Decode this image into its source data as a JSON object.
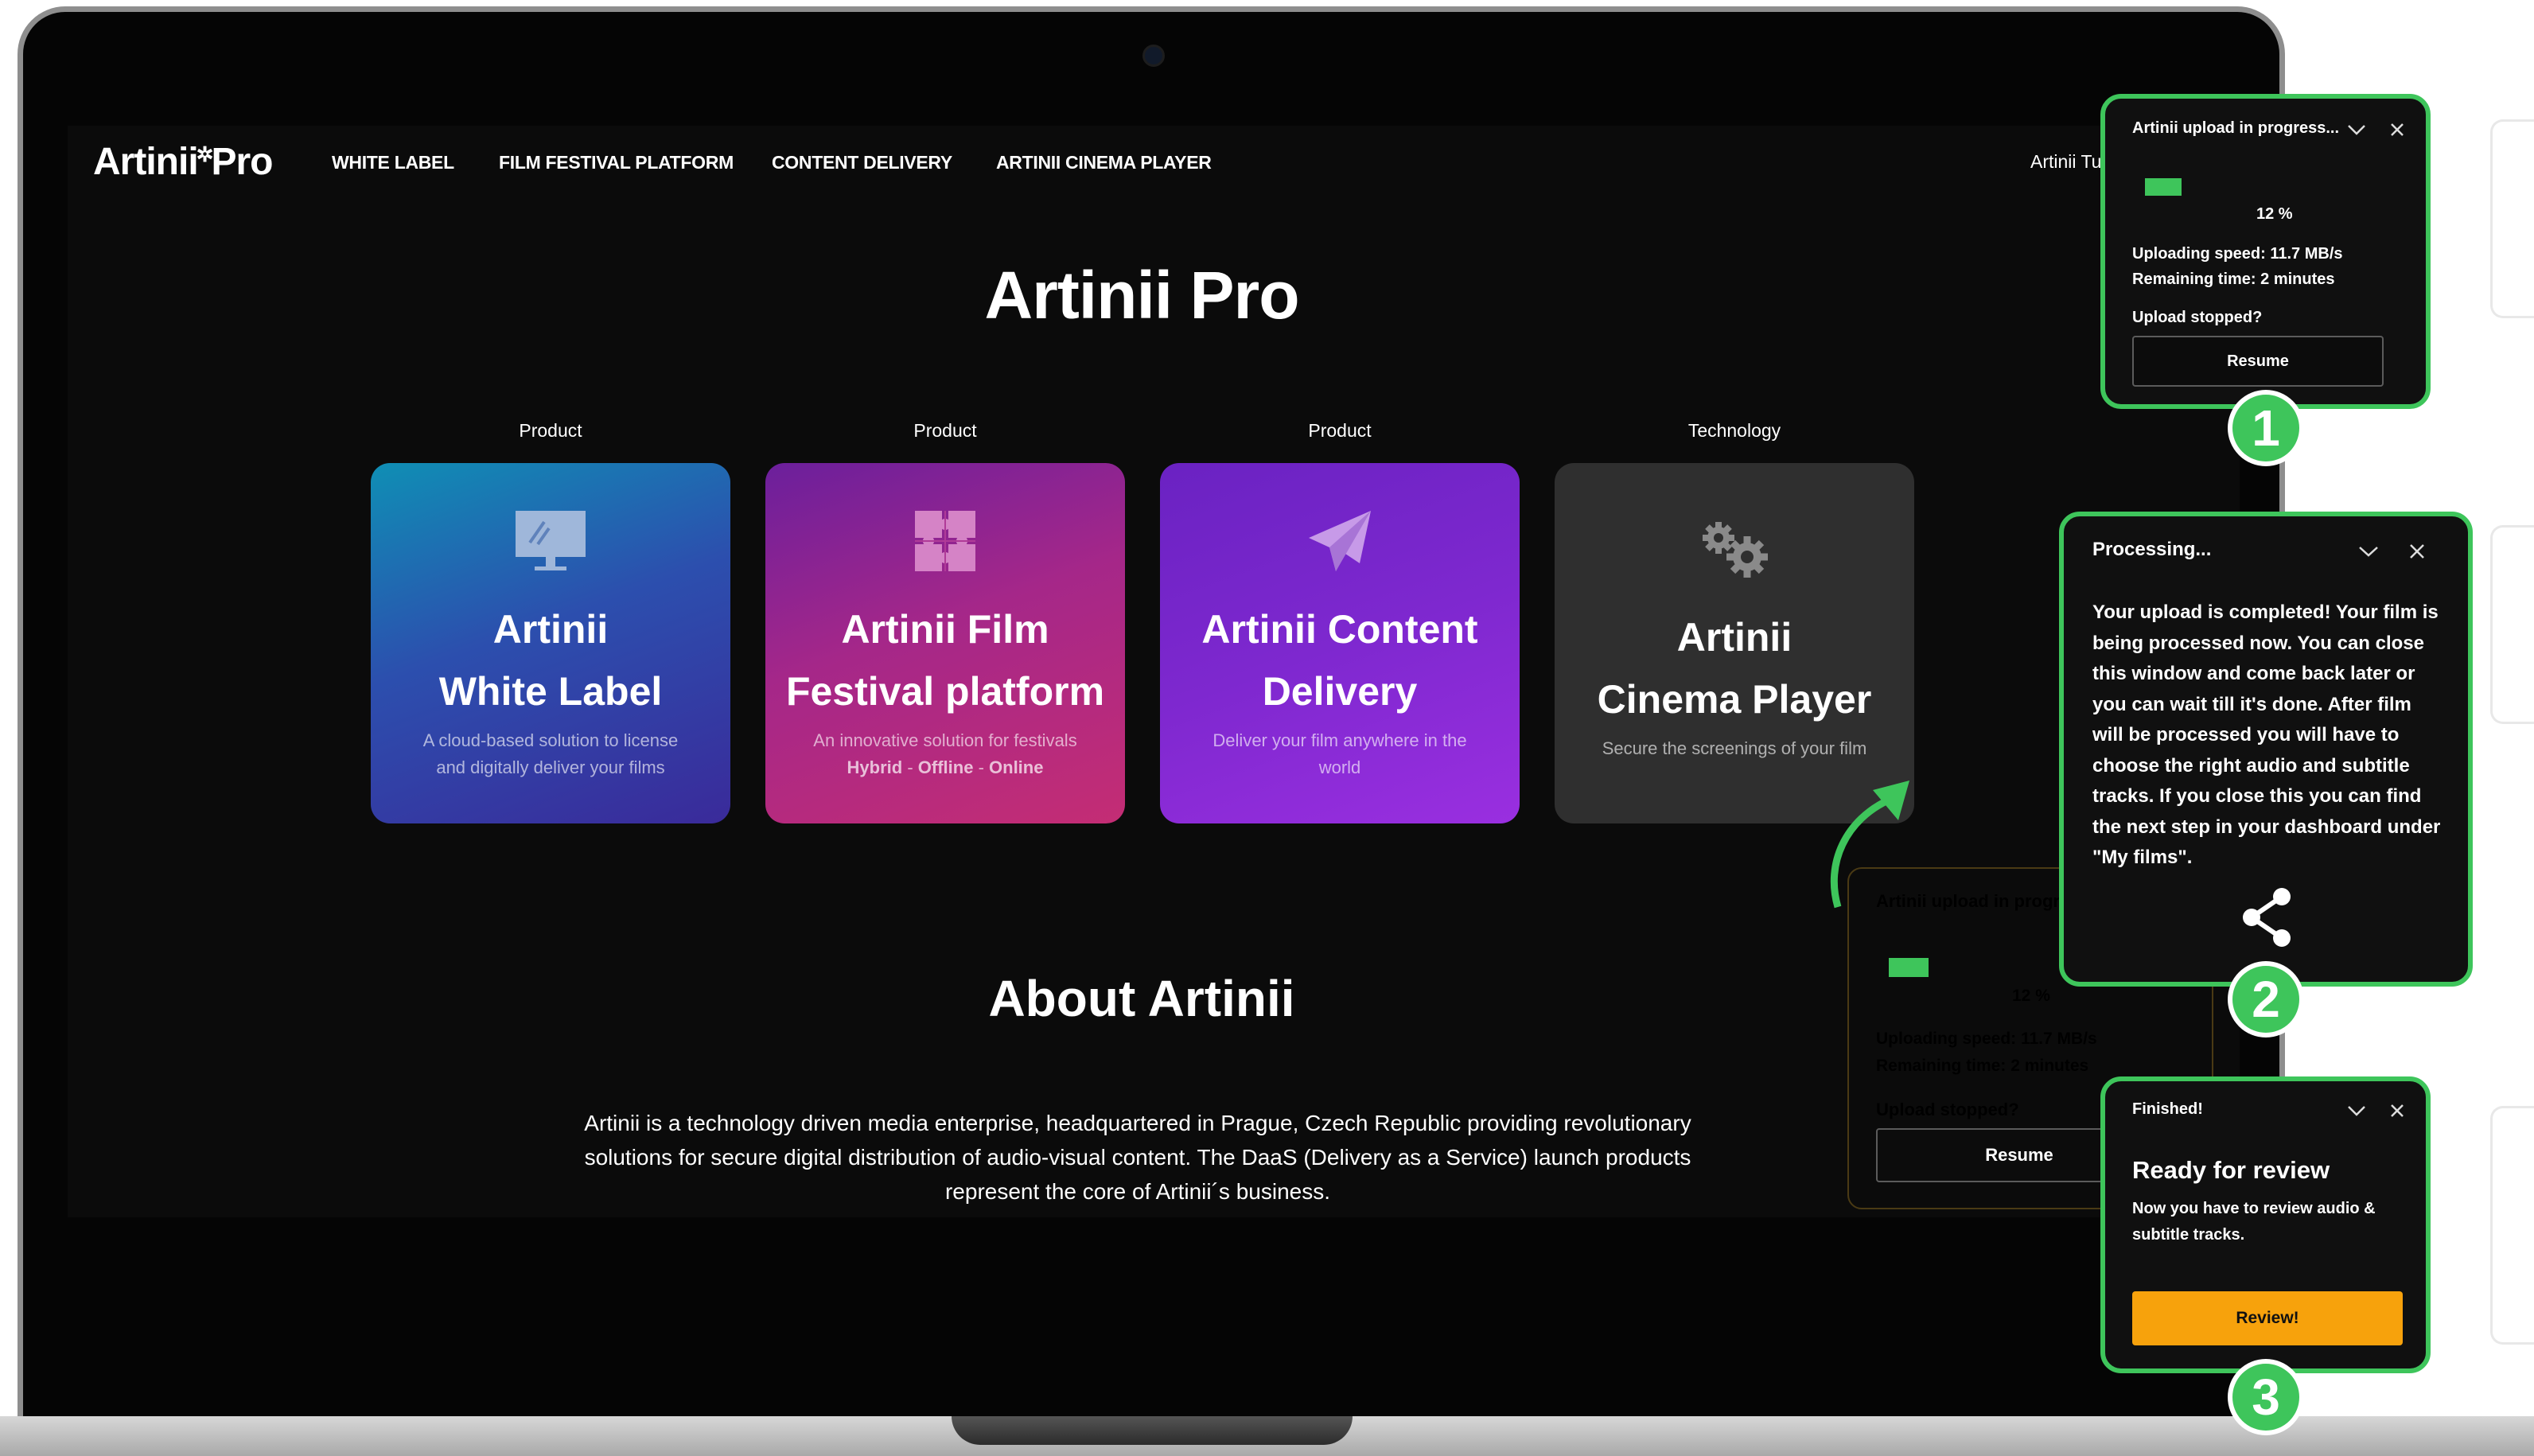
{
  "site": {
    "logo": {
      "left": "Artinii",
      "right": "Pro"
    },
    "nav": [
      "WHITE LABEL",
      "FILM FESTIVAL PLATFORM",
      "CONTENT DELIVERY",
      "ARTINII CINEMA PLAYER"
    ],
    "user_text": "Artinii Tu",
    "title": "Artinii Pro",
    "cards": [
      {
        "category": "Product",
        "title_line1": "Artinii",
        "title_line2": "White Label",
        "desc_line1": "A cloud-based solution to license",
        "desc_line2": "and digitally deliver your films",
        "icon": "monitor-icon",
        "gradient": [
          "#0f8fb5",
          "#3a2a9a"
        ]
      },
      {
        "category": "Product",
        "title_line1": "Artinii Film",
        "title_line2": "Festival platform",
        "desc_line1": "An innovative solution for festivals",
        "desc_tags": [
          "Hybrid",
          "Offline",
          "Online"
        ],
        "icon": "puzzle-icon",
        "gradient": [
          "#c4287a",
          "#5e1e9e"
        ]
      },
      {
        "category": "Product",
        "title_line1": "Artinii Content",
        "title_line2": "Delivery",
        "desc_line1": "Deliver your film anywhere in the",
        "desc_line2": "world",
        "icon": "paper-plane-icon",
        "gradient": [
          "#8e2dd8",
          "#5120b5"
        ]
      },
      {
        "category": "Technology",
        "title_line1": "Artinii",
        "title_line2": "Cinema Player",
        "desc_line1": "Secure the screenings of your film",
        "icon": "gears-icon",
        "gradient": [
          "#3a3a3a",
          "#2b2b2b"
        ]
      }
    ],
    "about_title": "About Artinii",
    "about_text": "Artinii is a technology driven media enterprise, headquartered in Prague, Czech Republic providing revolutionary solutions for secure digital distribution of audio-visual content. The DaaS (Delivery as a Service) launch products represent the core of Artinii´s business."
  },
  "embedded_upload": {
    "title": "Artinii upload in progre",
    "percent": "12 %",
    "progress": 0.12,
    "speed": "Uploading speed: 11.7 MB/s",
    "remaining": "Remaining time: 2 minutes",
    "stopped": "Upload stopped?",
    "button": "Resume"
  },
  "step1": {
    "title": "Artinii upload in progress...",
    "percent": "12 %",
    "progress": 0.12,
    "speed": "Uploading speed: 11.7 MB/s",
    "remaining": "Remaining time: 2 minutes",
    "stopped": "Upload stopped?",
    "button": "Resume",
    "badge": "1"
  },
  "step2": {
    "title": "Processing...",
    "body": "Your upload is completed! Your film is being processed now. You can close this window and come back later or you can wait till it's done. After film will be processed you will have to choose the right audio and subtitle tracks. If you close this you can find the next step in your dashboard under \"My films\".",
    "icon": "share-icon",
    "badge": "2"
  },
  "step3": {
    "title": "Finished!",
    "heading": "Ready for review",
    "body": "Now you have to review audio & subtitle tracks.",
    "button": "Review!",
    "badge": "3"
  },
  "colors": {
    "accent": "#3ec55b",
    "review": "#f7a20c"
  }
}
